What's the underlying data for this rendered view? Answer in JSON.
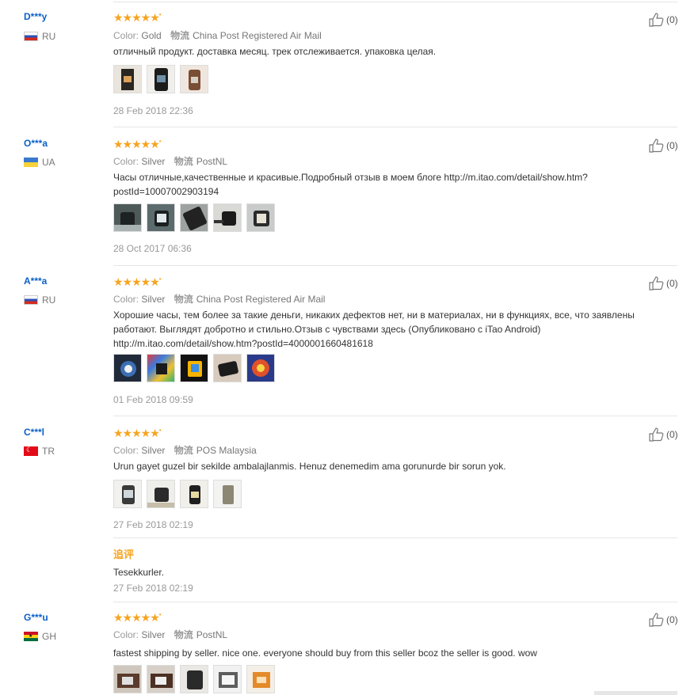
{
  "labels": {
    "color": "Color:",
    "logistics": "物流",
    "append": "追评"
  },
  "reviews": [
    {
      "user": "D***y",
      "country": "RU",
      "flag": "ru",
      "stars": "★★★★★",
      "color": "Gold",
      "shipping": "China Post Registered Air Mail",
      "text": "отличный продукт. доставка месяц. трек отслеживается. упаковка целая.",
      "date": "28 Feb 2018 22:36",
      "likes": "(0)"
    },
    {
      "user": "O***a",
      "country": "UA",
      "flag": "ua",
      "stars": "★★★★★",
      "color": "Silver",
      "shipping": "PostNL",
      "text": "Часы отличные,качественные и красивые.Подробный отзыв в моем блоге http://m.itao.com/detail/show.htm?postId=10007002903194",
      "date": "28 Oct 2017 06:36",
      "likes": "(0)"
    },
    {
      "user": "A***a",
      "country": "RU",
      "flag": "ru",
      "stars": "★★★★★",
      "color": "Silver",
      "shipping": "China Post Registered Air Mail",
      "text": "Хорошие часы, тем более за такие деньги, никаких дефектов нет, ни в материалах, ни в функциях, все, что заявлены работают. Выглядят добротно и стильно.Отзыв с чувствами здесь (Опубликовано с iTao Android) http://m.itao.com/detail/show.htm?postId=4000001660481618",
      "date": "01 Feb 2018 09:59",
      "likes": "(0)"
    },
    {
      "user": "C***l",
      "country": "TR",
      "flag": "tr",
      "stars": "★★★★★",
      "color": "Silver",
      "shipping": "POS Malaysia",
      "text": "Urun gayet guzel bir sekilde ambalajlanmis. Henuz denemedim ama gorunurde bir sorun yok.",
      "date": "27 Feb 2018 02:19",
      "likes": "(0)",
      "append_text": "Tesekkurler.",
      "append_date": "27 Feb 2018 02:19"
    },
    {
      "user": "G***u",
      "country": "GH",
      "flag": "gh",
      "stars": "★★★★★",
      "color": "Silver",
      "shipping": "PostNL",
      "text": "fastest shipping by seller. nice one. everyone should buy from this seller bcoz the seller is good. wow",
      "likes": "(0)"
    }
  ]
}
